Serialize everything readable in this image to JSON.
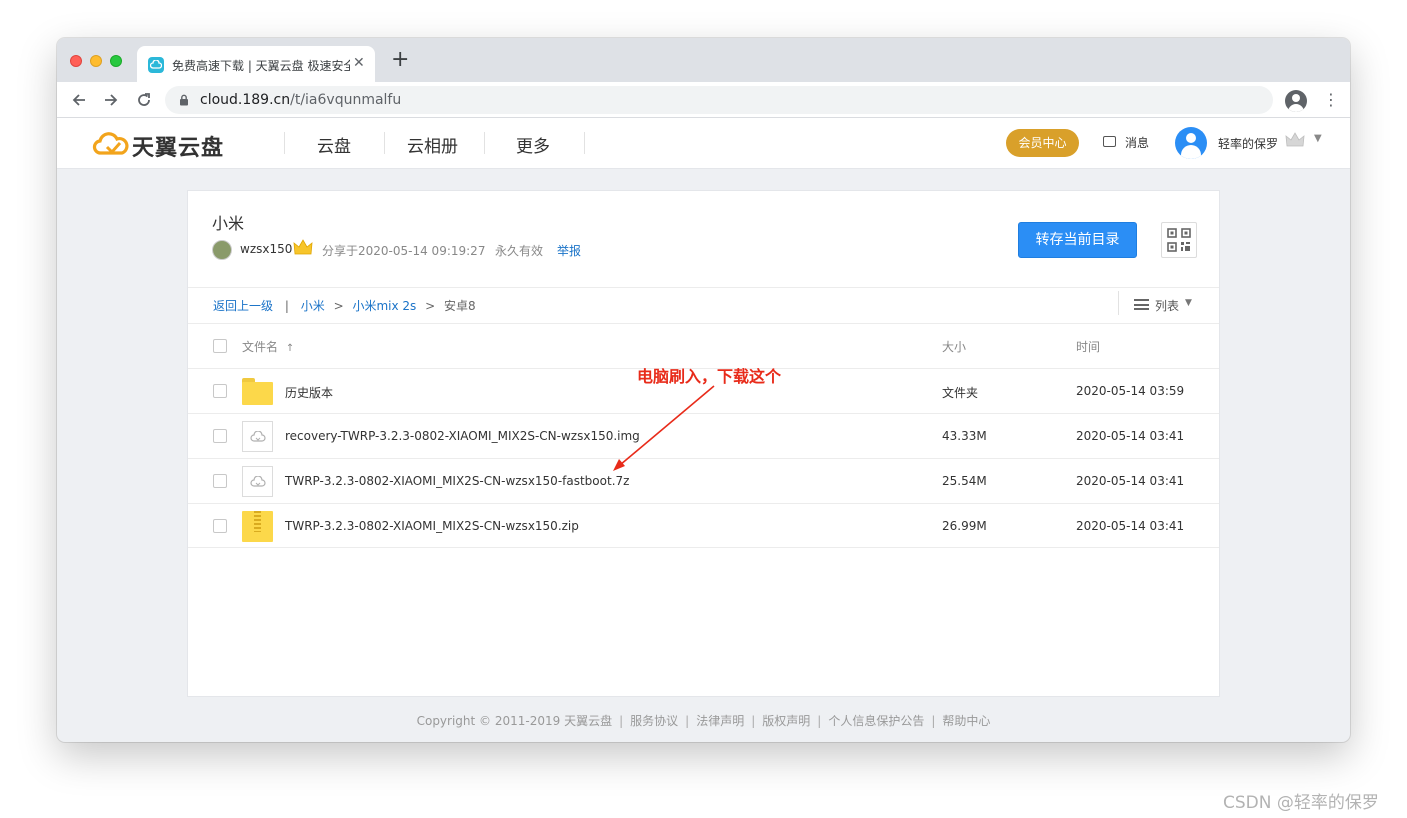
{
  "browser": {
    "tab_title": "免费高速下载 | 天翼云盘 极速安全 家庭云|网盘|文件备份|资源分享",
    "tab_close": "✕",
    "new_tab": "+",
    "url_host": "cloud.189.cn",
    "url_path": "/t/ia6vqunmalfu",
    "nav_icons": [
      "back-arrow-icon",
      "forward-arrow-icon",
      "reload-icon",
      "lock-icon",
      "star-icon",
      "profile-icon",
      "kebab-menu-icon"
    ]
  },
  "header": {
    "logo_text": "天翼云盘",
    "nav": [
      "云盘",
      "云相册",
      "更多"
    ],
    "vip_label": "会员中心",
    "messages_label": "消息",
    "username": "轻率的保罗"
  },
  "share": {
    "title": "小米",
    "sharer": "wzsx150",
    "share_time": "分享于2020-05-14 09:19:27",
    "validity": "永久有效",
    "report_label": "举报",
    "save_button": "转存当前目录"
  },
  "breadcrumb": {
    "back": "返回上一级",
    "sep": "|",
    "items": [
      "小米",
      "小米mix 2s"
    ],
    "arrow": ">",
    "current": "安卓8"
  },
  "view": {
    "label": "列表",
    "caret": "▼"
  },
  "table": {
    "headers": {
      "name": "文件名",
      "sort_arrow": "↑",
      "size": "大小",
      "time": "时间"
    },
    "rows": [
      {
        "name": "历史版本",
        "size": "文件夹",
        "time": "2020-05-14 03:59",
        "icon": "folder-icon"
      },
      {
        "name": "recovery-TWRP-3.2.3-0802-XIAOMI_MIX2S-CN-wzsx150.img",
        "size": "43.33M",
        "time": "2020-05-14 03:41",
        "icon": "file-cloud-icon"
      },
      {
        "name": "TWRP-3.2.3-0802-XIAOMI_MIX2S-CN-wzsx150-fastboot.7z",
        "size": "25.54M",
        "time": "2020-05-14 03:41",
        "icon": "file-cloud-icon"
      },
      {
        "name": "TWRP-3.2.3-0802-XIAOMI_MIX2S-CN-wzsx150.zip",
        "size": "26.99M",
        "time": "2020-05-14 03:41",
        "icon": "zip-icon"
      }
    ]
  },
  "annotation": {
    "text": "电脑刷入，下载这个",
    "color": "#e82b1a"
  },
  "footer": {
    "copyright": "Copyright © 2011-2019 天翼云盘",
    "links": [
      "服务协议",
      "法律声明",
      "版权声明",
      "个人信息保护公告",
      "帮助中心"
    ],
    "sep": "|"
  },
  "watermark": "CSDN @轻率的保罗",
  "colors": {
    "accent": "#2b8ef5",
    "vip": "#d9a02a",
    "link": "#1a73c8"
  }
}
